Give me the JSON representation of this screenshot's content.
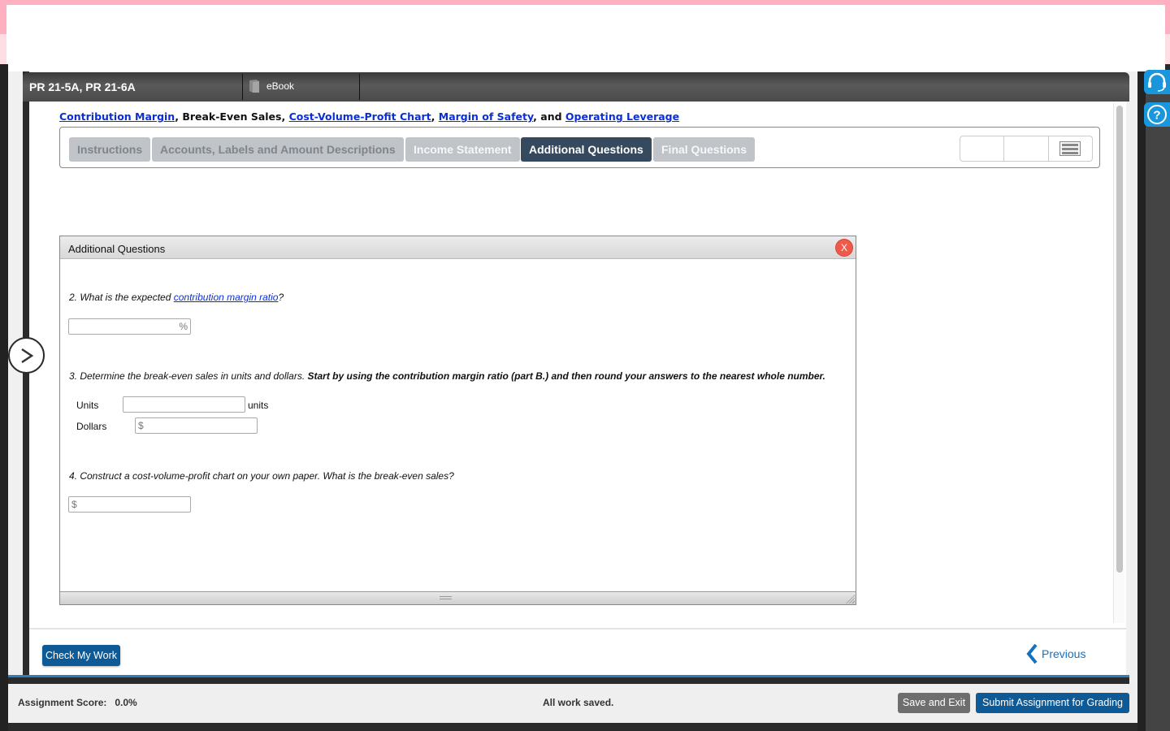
{
  "window": {
    "title": "PR 21-5A, PR 21-6A",
    "ebook_label": "eBook"
  },
  "topics": {
    "links": [
      "Contribution Margin",
      "Break-Even Sales",
      "Cost-Volume-Profit Chart",
      "Margin of Safety",
      "Operating Leverage"
    ],
    "sep1": ", ",
    "sep3": ", ",
    "sep4": ", and "
  },
  "tabs": [
    {
      "label": "Instructions",
      "state": "visited"
    },
    {
      "label": "Accounts, Labels and Amount Descriptions",
      "state": "visited"
    },
    {
      "label": "Income Statement",
      "state": "inactive"
    },
    {
      "label": "Additional Questions",
      "state": "active"
    },
    {
      "label": "Final Questions",
      "state": "inactive"
    }
  ],
  "toolbar": {
    "tools": [
      "blank-tool-1",
      "blank-tool-2",
      "menu-icon"
    ]
  },
  "dialog": {
    "title": "Additional Questions",
    "close_label": "X",
    "q2": {
      "prefix": "2. What is the expected ",
      "link": "contribution margin ratio",
      "suffix": "?",
      "input_value": "",
      "unit": "%"
    },
    "q3": {
      "text": "3. Determine the break-even sales in units and dollars. ",
      "bold": "Start by using the contribution margin ratio (part B.) and then round your answers to the nearest whole number.",
      "units_label": "Units",
      "units_value": "",
      "units_suffix": "units",
      "dollars_label": "Dollars",
      "dollars_prefix": "$",
      "dollars_value": ""
    },
    "q4": {
      "text": "4. Construct a cost-volume-profit chart on your own paper. What is the break-even sales?",
      "prefix": "$",
      "value": ""
    }
  },
  "nav": {
    "check_label": "Check My Work",
    "previous_label": "Previous"
  },
  "status": {
    "score_label": "Assignment Score:",
    "score_value": "0.0%",
    "saved_text": "All work saved.",
    "save_exit_label": "Save and Exit",
    "submit_label": "Submit Assignment for Grading"
  },
  "side_icons": [
    "headset-icon",
    "help-icon"
  ],
  "colors": {
    "active_tab": "#354a5f",
    "primary_button": "#0e5a97",
    "link": "#0b2fd6",
    "close": "#f05a4a",
    "side_icon": "#1a96dc"
  }
}
